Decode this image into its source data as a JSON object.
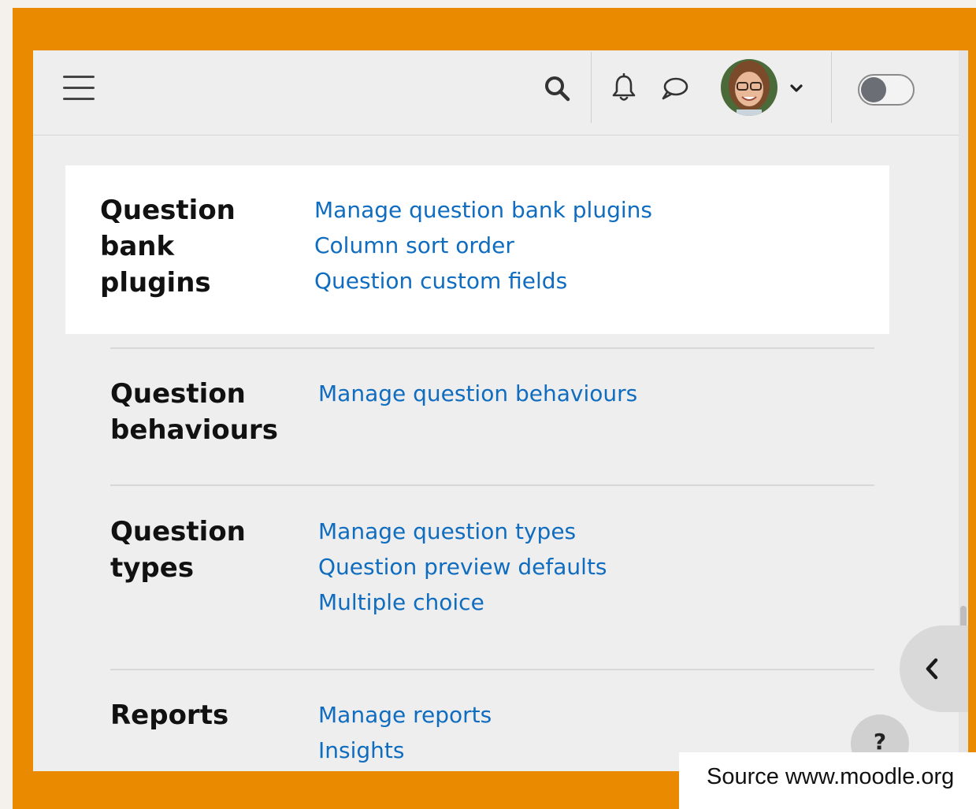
{
  "navbar": {
    "menu_icon": "hamburger-menu-icon",
    "search_icon": "search-icon",
    "notifications_icon": "bell-icon",
    "messages_icon": "chat-bubble-icon",
    "user_menu_icon": "chevron-down-icon",
    "theme_toggle": {
      "state": "off"
    }
  },
  "sections": [
    {
      "heading": "Question bank plugins",
      "links": [
        "Manage question bank plugins",
        "Column sort order",
        "Question custom fields"
      ]
    },
    {
      "heading": "Question behaviours",
      "links": [
        "Manage question behaviours"
      ]
    },
    {
      "heading": "Question types",
      "links": [
        "Manage question types",
        "Question preview defaults",
        "Multiple choice"
      ]
    },
    {
      "heading": "Reports",
      "links": [
        "Manage reports",
        "Insights"
      ]
    }
  ],
  "drawer_toggle_icon": "chevron-left-icon",
  "help_button": {
    "label": "?"
  },
  "source": "Source www.moodle.org",
  "colors": {
    "frame": "#ea8a00",
    "link": "#0f6cbf",
    "heading": "#111111"
  }
}
